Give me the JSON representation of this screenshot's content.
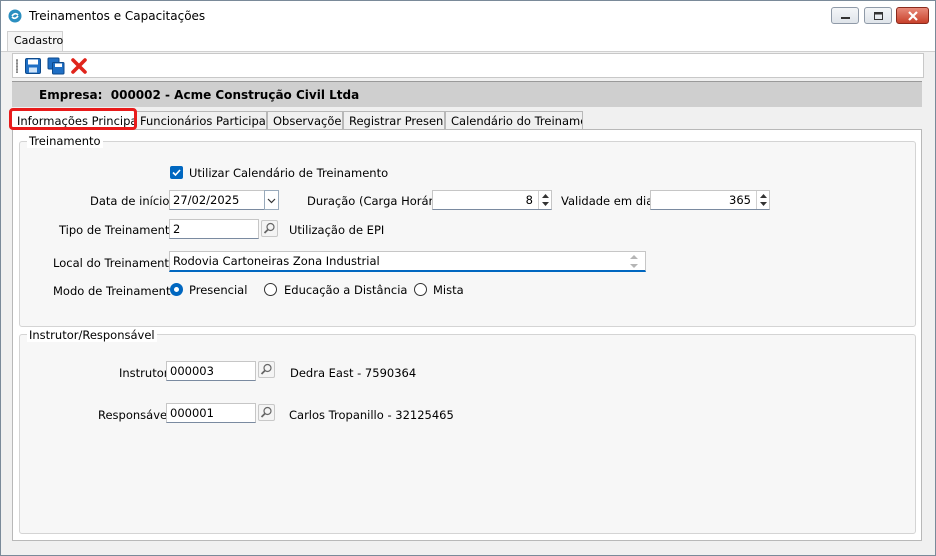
{
  "window": {
    "title": "Treinamentos e Capacitações",
    "minimize_icon": "minimize-icon",
    "maximize_icon": "maximize-icon",
    "close_icon": "close-icon"
  },
  "menu": {
    "tab_label": "Cadastro"
  },
  "toolbar": {
    "items": [
      "save-icon",
      "save-copy-icon",
      "delete-icon"
    ]
  },
  "empresa": {
    "label": "Empresa:  000002 - Acme Construção Civil Ltda"
  },
  "tabs": [
    {
      "label": "Informações Principais"
    },
    {
      "label": "Funcionários Participantes"
    },
    {
      "label": "Observações"
    },
    {
      "label": "Registrar Presença"
    },
    {
      "label": "Calendário do Treinamento"
    }
  ],
  "treinamento": {
    "group_title": "Treinamento",
    "use_calendar_label": "Utilizar Calendário de Treinamento",
    "use_calendar_checked": true,
    "data_inicio_label": "Data de início:",
    "data_inicio_value": "27/02/2025",
    "duracao_label": "Duração (Carga Horária)",
    "duracao_value": "8",
    "validade_label": "Validade em dias",
    "validade_value": "365",
    "tipo_label": "Tipo de Treinamento:",
    "tipo_value": "2",
    "tipo_desc": "Utilização de EPI",
    "local_label": "Local do Treinamento:",
    "local_value": "Rodovia Cartoneiras Zona Industrial",
    "modo_label": "Modo de Treinamento:",
    "modo_options": [
      "Presencial",
      "Educação a Distância",
      "Mista"
    ],
    "modo_selected": "Presencial"
  },
  "instrutor": {
    "group_title": "Instrutor/Responsável",
    "instrutor_label": "Instrutor:",
    "instrutor_value": "000003",
    "instrutor_desc": "Dedra East - 7590364",
    "responsavel_label": "Responsável:",
    "responsavel_value": "000001",
    "responsavel_desc": "Carlos Tropanillo - 32125465"
  },
  "colors": {
    "accent": "#0067c0",
    "highlight": "#e81b1b",
    "close_button": "#c8412b"
  }
}
